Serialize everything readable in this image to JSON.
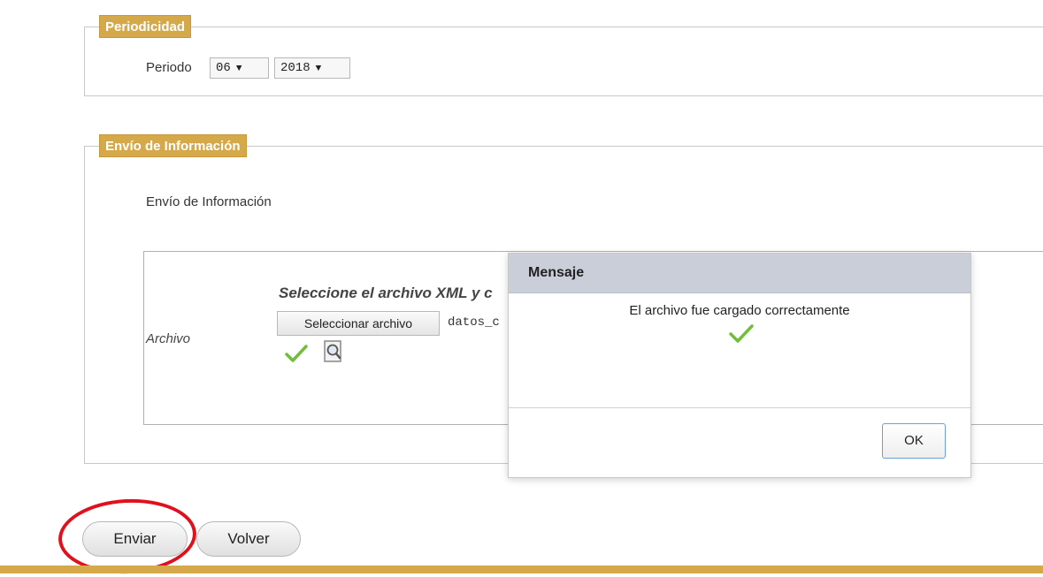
{
  "periodicidad": {
    "legend": "Periodicidad",
    "periodo_label": "Periodo",
    "month_value": "06",
    "year_value": "2018"
  },
  "envio": {
    "legend": "Envío de Información",
    "description": "Envío de Información",
    "archivo_label": "Archivo",
    "select_heading": "Seleccione el archivo XML y c",
    "file_button": "Seleccionar archivo",
    "file_name": "datos_c"
  },
  "dialog": {
    "title": "Mensaje",
    "message": "El archivo fue cargado correctamente",
    "ok_label": "OK"
  },
  "buttons": {
    "enviar": "Enviar",
    "volver": "Volver"
  },
  "colors": {
    "legend_bg": "#d5a94a",
    "dialog_header_bg": "#c9ced8",
    "check_green": "#6fbf3a",
    "annotation_red": "#e0101c"
  },
  "icons": {
    "dropdown": "dropdown-arrow-icon",
    "success": "checkmark-icon",
    "preview": "magnifier-document-icon"
  }
}
